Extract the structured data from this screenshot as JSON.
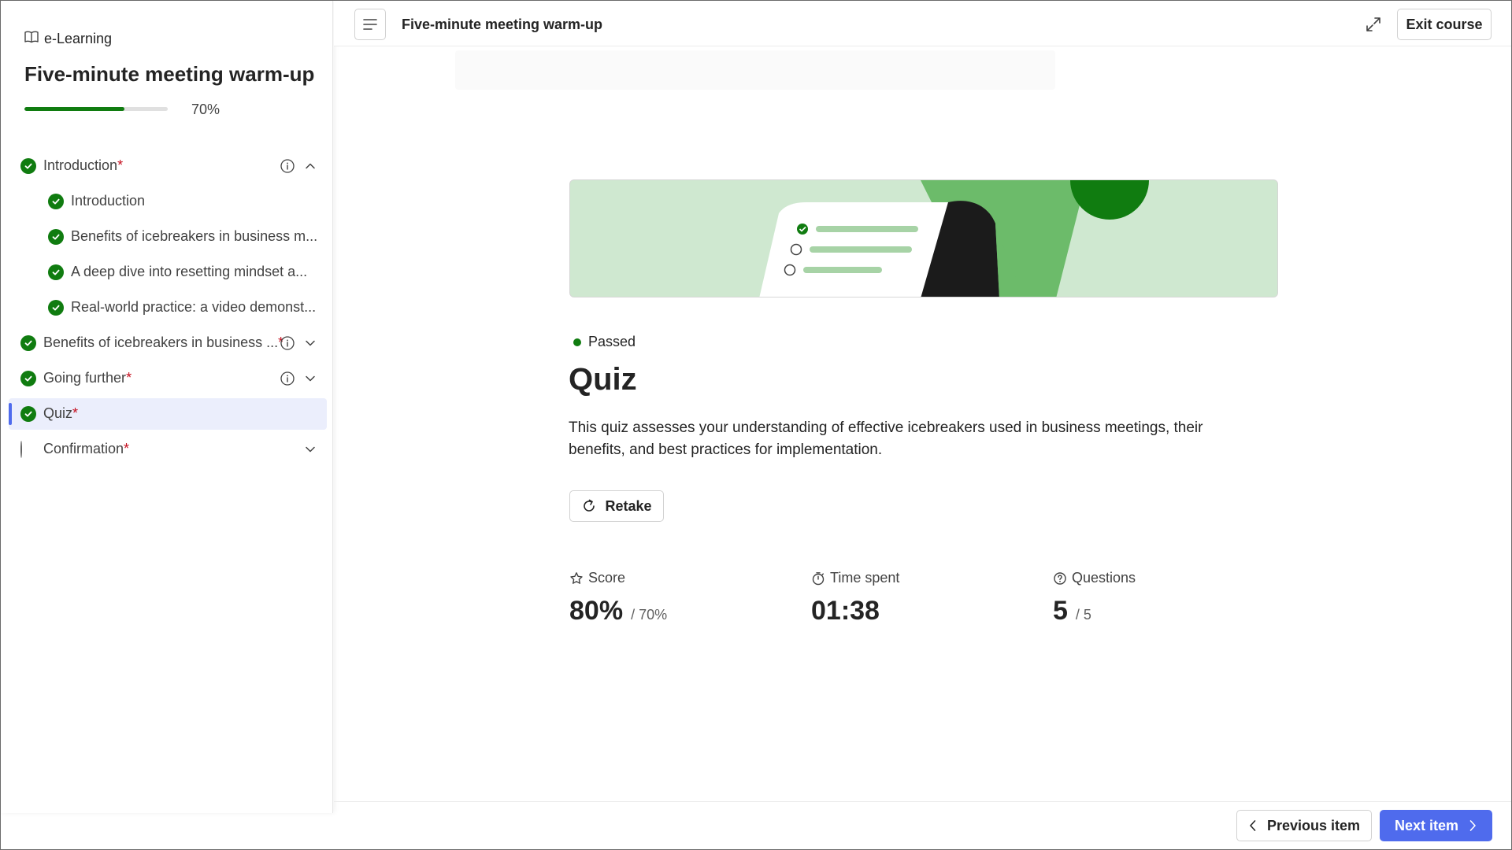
{
  "app": {
    "brand": "e-Learning"
  },
  "course": {
    "title": "Five-minute meeting warm-up",
    "progress_text": "70%",
    "progress_fraction": 0.7
  },
  "topbar": {
    "title": "Five-minute meeting warm-up",
    "exit_label": "Exit course"
  },
  "nav": {
    "required_mark": "*",
    "items": [
      {
        "label": "Introduction",
        "required": true,
        "status": "complete",
        "level": 0,
        "info": true,
        "chevron": "up"
      },
      {
        "label": "Introduction",
        "required": false,
        "status": "complete",
        "level": 1
      },
      {
        "label": "Benefits of icebreakers in business m...",
        "required": false,
        "status": "complete",
        "level": 1
      },
      {
        "label": "A deep dive into resetting mindset a...",
        "required": false,
        "status": "complete",
        "level": 1
      },
      {
        "label": "Real-world practice: a video demonst...",
        "required": false,
        "status": "complete",
        "level": 1
      },
      {
        "label": "Benefits of icebreakers in business ...",
        "required": true,
        "status": "complete",
        "level": 0,
        "info": true,
        "chevron": "down"
      },
      {
        "label": "Going further",
        "required": true,
        "status": "complete",
        "level": 0,
        "info": true,
        "chevron": "down"
      },
      {
        "label": "Quiz",
        "required": true,
        "status": "complete",
        "level": 0,
        "active": true
      },
      {
        "label": "Confirmation",
        "required": true,
        "status": "incomplete",
        "level": 0,
        "chevron": "down"
      }
    ]
  },
  "quiz": {
    "status": "Passed",
    "title": "Quiz",
    "description": "This quiz assesses your understanding of effective icebreakers used in business meetings, their benefits, and best practices for implementation.",
    "retake_label": "Retake",
    "stats": {
      "score": {
        "label": "Score",
        "value": "80%",
        "sub": "/ 70%"
      },
      "time": {
        "label": "Time spent",
        "value": "01:38"
      },
      "questions": {
        "label": "Questions",
        "value": "5",
        "sub": "/ 5"
      }
    }
  },
  "footer": {
    "prev_label": "Previous item",
    "next_label": "Next item"
  },
  "colors": {
    "accent": "#4f6bed",
    "success": "#107c10",
    "required": "#c50f1f"
  },
  "icons": {
    "brand": "book-icon",
    "menu": "hamburger-menu-icon",
    "expand": "expand-icon",
    "retake": "refresh-icon",
    "score": "star-icon",
    "time": "timer-icon",
    "questions": "question-circle-icon",
    "prev": "chevron-left-icon",
    "next": "chevron-right-icon"
  }
}
